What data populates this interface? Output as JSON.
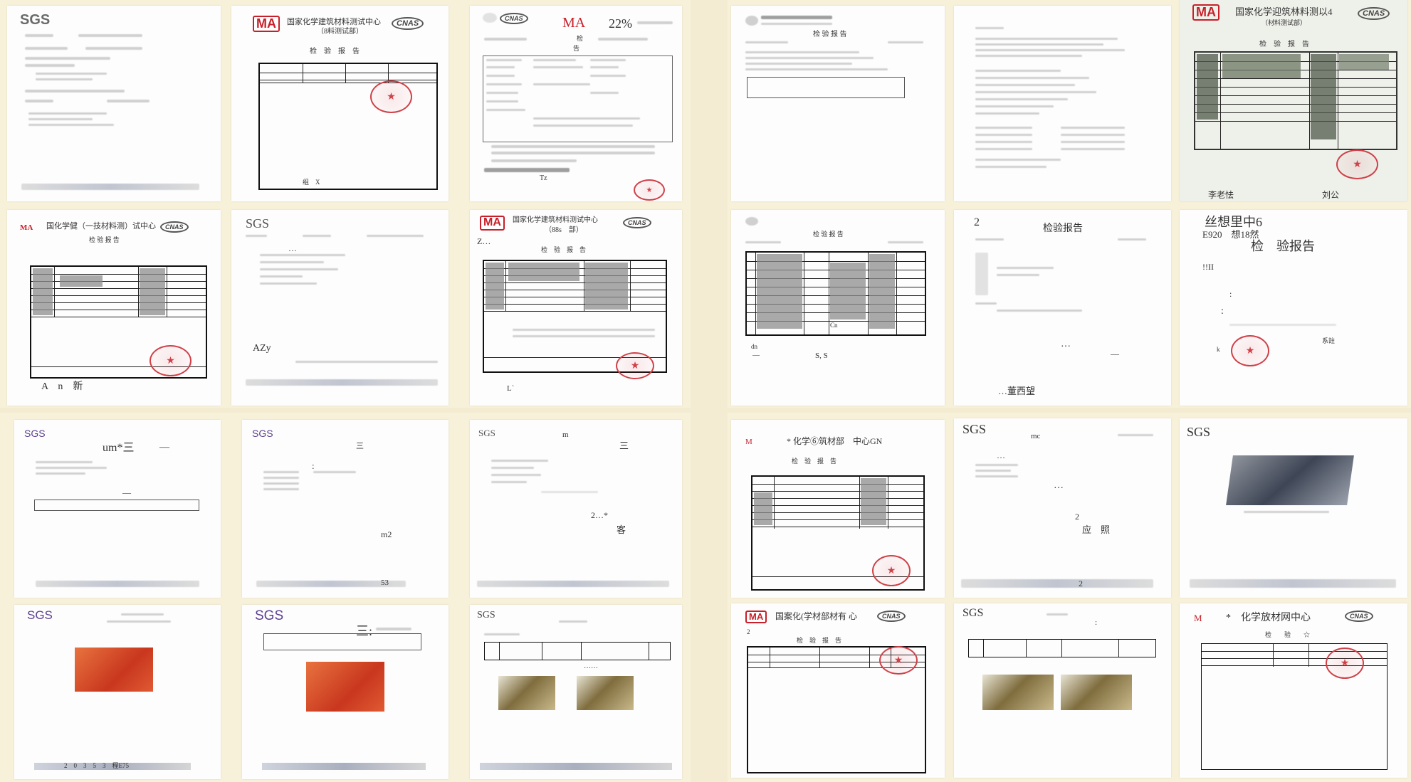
{
  "panels": {
    "p1": {
      "logo": "SGS"
    },
    "p2": {
      "org": "国家化学建筑材料测试中心",
      "sub": "（8料测试部）",
      "title": "检　验　报　告",
      "foot": "组　X"
    },
    "p3": {
      "ma": "MA",
      "pct": "22%",
      "title1": "检",
      "title2": "告",
      "foot": "Tz"
    },
    "p4": {
      "ma": "MA",
      "org": "国化学健（一技材料测）试中心",
      "title": "检 验 报 告",
      "foot": "A　n　新"
    },
    "p5": {
      "logo": "SGS",
      "dots": "…",
      "mid": "AZy"
    },
    "p6": {
      "org": "国家化学建筑材料测试中心",
      "sub": "（88s　部）",
      "z": "Z…",
      "title": "检　验　报　告",
      "foot": "L`"
    },
    "q2p1": {
      "title": "检 验 报 告"
    },
    "q2p3": {
      "ma": "MA",
      "org": "国家化学迎筑林料测以4",
      "sub": "（材料测试部）",
      "title": "检　验　报　告",
      "sign1": "李老怯",
      "sign2": "刘公"
    },
    "q2p4": {
      "title": "检 验 报 告",
      "cn": "Cn",
      "ss": "S, S",
      "dn": "dn"
    },
    "q2p5": {
      "two": "2",
      "title": "检验报告",
      "dots": "…",
      "foot": "…董西望"
    },
    "q2p6": {
      "head": "丝想里中6",
      "sub": "E920　想18然",
      "title": "检　验报告",
      "ii": "!!II",
      "colon": ":",
      "k": "k",
      "sys": "系註"
    },
    "q3p1": {
      "logo": "SGS",
      "um": "um*三",
      "dash": "—"
    },
    "q3p2": {
      "logo": "SGS",
      "san": "三",
      "m2": "m2",
      "num": "53"
    },
    "q3p3": {
      "logo": "SGS",
      "m": "m",
      "san": "三",
      "two": "2…*",
      "ke": "客"
    },
    "q3p4": {
      "logo": "SGS",
      "foot": "2　0　3　5　3　程E75"
    },
    "q3p5": {
      "logo": "SGS",
      "san": "三:"
    },
    "q3p6": {
      "logo": "SGS",
      "dots": "……"
    },
    "q4p1": {
      "m": "M",
      "org": "* 化学⑥筑材部　中心GN",
      "title": "检　验　报　告"
    },
    "q4p2": {
      "logo": "SGS",
      "mc": "mc",
      "dots": "…",
      "two": "2",
      "ying": "应　照",
      "two2": "2"
    },
    "q4p3": {
      "logo": "SGS"
    },
    "q4p4": {
      "org": "国案化(学材部材有 心",
      "title": "检　验　报　告",
      "two": "2"
    },
    "q4p5": {
      "logo": "SGS"
    },
    "q4p6": {
      "m": "M",
      "org": "*　化学放材网中心",
      "title": "检　　验　　☆"
    }
  },
  "colors": {
    "background": "#f4ecd2",
    "stamp": "#d04048",
    "ma": "#c8202a",
    "sgs_purple": "#5b3f91"
  }
}
